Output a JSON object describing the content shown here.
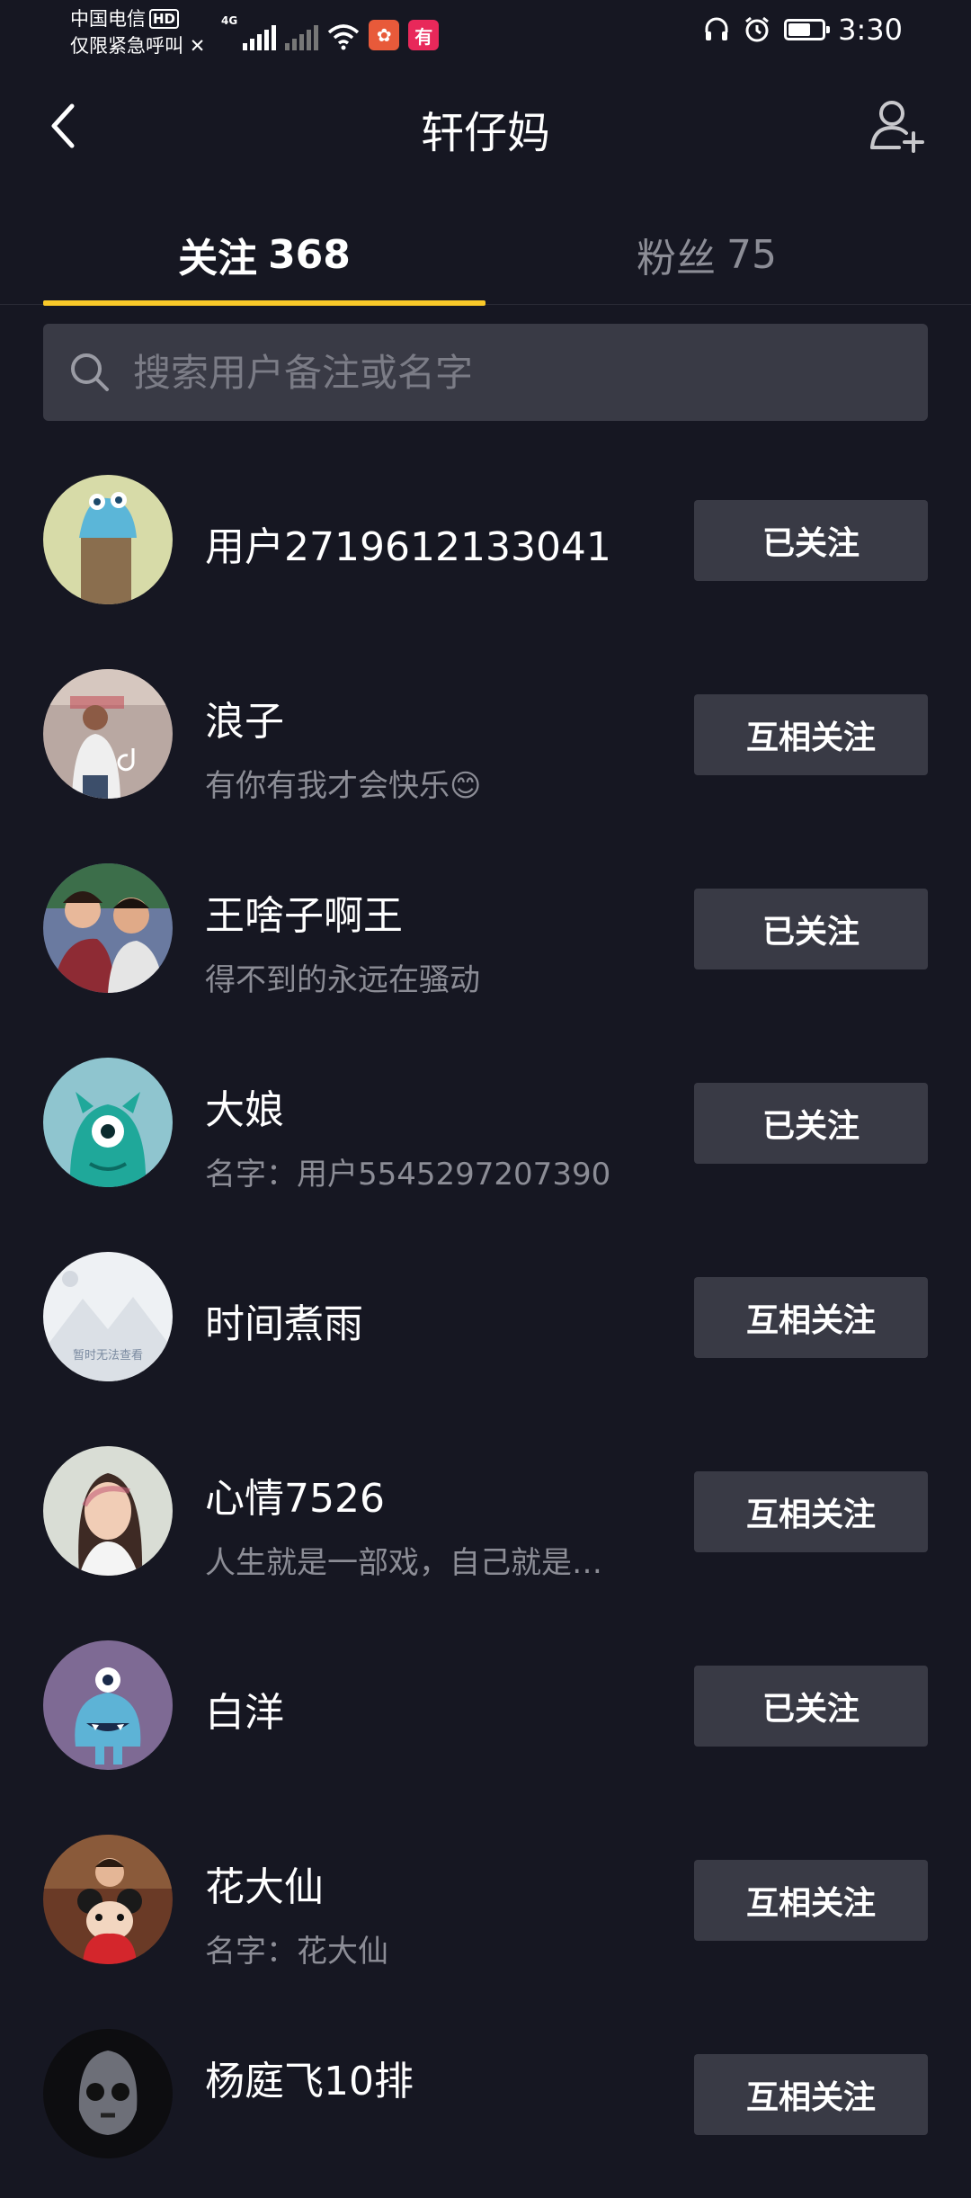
{
  "status_bar": {
    "carrier": "中国电信",
    "hd_badge": "HD",
    "emergency": "仅限紧急呼叫",
    "network_type": "4G",
    "app_badge_text": "有",
    "time": "3:30",
    "battery_level": 0.6
  },
  "header": {
    "title": "轩仔妈",
    "back_icon": "chevron-left-icon",
    "add_user_icon": "add-user-icon"
  },
  "tabs": [
    {
      "label": "关注",
      "count": "368",
      "active": true
    },
    {
      "label": "粉丝",
      "count": "75",
      "active": false
    }
  ],
  "accent_color": "#f9c929",
  "search": {
    "placeholder": "搜索用户备注或名字",
    "value": ""
  },
  "users": [
    {
      "name": "用户2719612133041",
      "sub": "",
      "button": "已关注"
    },
    {
      "name": "浪子",
      "sub": "有你有我才会快乐😊",
      "button": "互相关注"
    },
    {
      "name": "王啥子啊王",
      "sub": "得不到的永远在骚动",
      "button": "已关注"
    },
    {
      "name": "大娘",
      "sub": "名字：用户5545297207390",
      "button": "已关注"
    },
    {
      "name": "时间煮雨",
      "sub": "",
      "button": "互相关注",
      "avatar_text": "暂时无法查看"
    },
    {
      "name": "心情7526",
      "sub": "人生就是一部戏，自己就是…",
      "button": "互相关注"
    },
    {
      "name": "白洋",
      "sub": "",
      "button": "已关注"
    },
    {
      "name": "花大仙",
      "sub": "名字：花大仙",
      "button": "互相关注"
    },
    {
      "name": "杨庭飞10排",
      "sub": "",
      "button": "互相关注"
    }
  ]
}
